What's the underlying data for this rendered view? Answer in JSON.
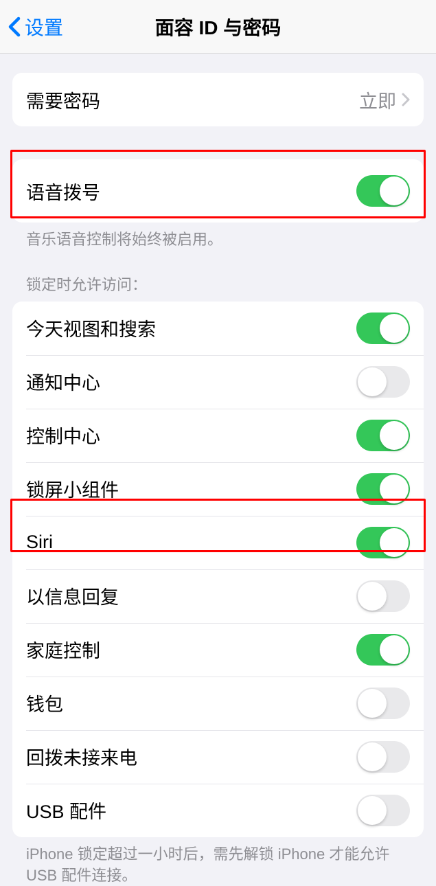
{
  "header": {
    "back_label": "设置",
    "title": "面容 ID 与密码"
  },
  "require_passcode": {
    "label": "需要密码",
    "value": "立即"
  },
  "voice_dial": {
    "label": "语音拨号",
    "on": true,
    "footer": "音乐语音控制将始终被启用。"
  },
  "lock_access": {
    "header": "锁定时允许访问：",
    "items": [
      {
        "label": "今天视图和搜索",
        "on": true
      },
      {
        "label": "通知中心",
        "on": false
      },
      {
        "label": "控制中心",
        "on": true
      },
      {
        "label": "锁屏小组件",
        "on": true
      },
      {
        "label": "Siri",
        "on": true
      },
      {
        "label": "以信息回复",
        "on": false
      },
      {
        "label": "家庭控制",
        "on": true
      },
      {
        "label": "钱包",
        "on": false
      },
      {
        "label": "回拨未接来电",
        "on": false
      },
      {
        "label": "USB 配件",
        "on": false
      }
    ],
    "footer": "iPhone 锁定超过一小时后，需先解锁 iPhone 才能允许 USB 配件连接。"
  }
}
